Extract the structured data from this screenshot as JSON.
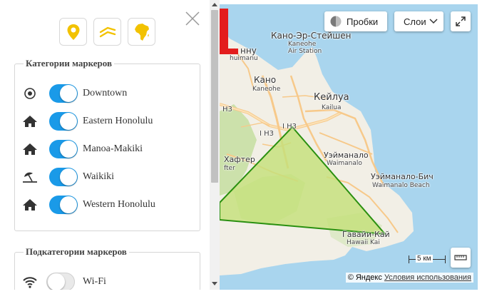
{
  "panel": {
    "toolbar": {
      "buttons": [
        {
          "icon": "map-marker-icon",
          "color": "#f2c200"
        },
        {
          "icon": "route-lines-icon",
          "color": "#f2c200"
        },
        {
          "icon": "continent-africa-icon",
          "color": "#f2c200"
        }
      ],
      "close_icon": "close-icon"
    },
    "categories": {
      "title": "Категории маркеров",
      "items": [
        {
          "label": "Downtown",
          "icon": "target-circle-icon",
          "enabled": true
        },
        {
          "label": "Eastern Honolulu",
          "icon": "home-icon",
          "enabled": true
        },
        {
          "label": "Manoa-Makiki",
          "icon": "home-icon",
          "enabled": true
        },
        {
          "label": "Waikiki",
          "icon": "beach-umbrella-icon",
          "enabled": true
        },
        {
          "label": "Western Honolulu",
          "icon": "home-icon",
          "enabled": true
        }
      ]
    },
    "subcategories": {
      "title": "Подкатегории маркеров",
      "items": [
        {
          "label": "Wi-Fi",
          "icon": "wifi-icon",
          "enabled": false
        }
      ]
    },
    "toggle_color": "#1a9ae8"
  },
  "map": {
    "controls": {
      "traffic_label": "Пробки",
      "layers_label": "Слои",
      "fullscreen_icon": "fullscreen-icon",
      "ruler_icon": "ruler-icon"
    },
    "places": {
      "kaneohe_station_ru": "Кано-Эр-Стейшен",
      "kaneohe_station_en1": "Kaneohe",
      "kaneohe_station_en2": "Air Station",
      "kahaluu_ru": "нну",
      "kahaluu_en": "huimanu",
      "kaneohe_ru": "Кано",
      "kaneohe_en": "Kaneohe",
      "kailua_ru": "Кейлуа",
      "kailua_en": "Kailua",
      "h3_west": "H3",
      "h3_center": "I H3",
      "h3_east": "I H3",
      "waimanalo_ru": "Уэйманало",
      "waimanalo_en": "Waimanalo",
      "waimanalo_beach_ru": "Уэйманало-Бич",
      "waimanalo_beach_en": "Waimanalo Beach",
      "halawa_ru": "Хафтер",
      "halawa_en": "fter",
      "hawaii_kai_ru": "Гавайи-Кай",
      "hawaii_kai_en": "Hawaii Kai"
    },
    "scale_label": "5 км",
    "copyright": "© Яндекс",
    "terms_link": "Условия использования",
    "polygon_fill": "#c5e07a",
    "polygon_stroke": "#2a9010"
  }
}
